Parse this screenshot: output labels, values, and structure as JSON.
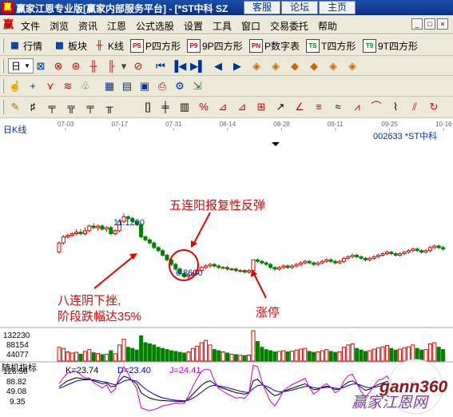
{
  "window": {
    "title": "赢家江恩专业版[赢家内部服务平台] - [*ST中科  SZ",
    "logo": "赢",
    "buttons": [
      "客服",
      "论坛",
      "主页"
    ]
  },
  "menu": {
    "items": [
      "文件",
      "浏览",
      "资讯",
      "江恩",
      "公式选股",
      "设置",
      "工具",
      "窗口",
      "交易委托",
      "帮助"
    ],
    "window_controls": [
      "_",
      "□",
      "×"
    ]
  },
  "toolbar1": {
    "items": [
      "行情",
      "板块",
      "K线",
      "P四方形",
      "9P四方形",
      "P数字表",
      "T四方形",
      "9T四方形"
    ],
    "icons": [
      "PS",
      "P9",
      "PN",
      "TS",
      "T9"
    ]
  },
  "toolbar2": {
    "period": "日"
  },
  "chart": {
    "title": "日K线",
    "stock": "002633 *ST中科",
    "dates": [
      "07-03",
      "07-17",
      "07-31",
      "08-14",
      "08-28",
      "09-11",
      "09-25",
      "10-16"
    ],
    "high_label": "11.1200",
    "low_label": "6.8600",
    "volume_ticks": [
      "132230",
      "88154",
      "44077"
    ],
    "indicator_name": "随机指标",
    "indicator_values": [
      "K=23.74",
      "D=23.40",
      "J=24.41"
    ],
    "indicator_ticks": [
      "126.56",
      "88.82",
      "49.08",
      "9.35"
    ],
    "annotations": [
      "五连阳报复性反弹",
      "八连阴下挫,",
      "阶段跌幅达35%",
      "涨停"
    ],
    "watermark": "gann360",
    "watermark_cn": "赢家江恩网"
  },
  "colors": {
    "up": "#e00000",
    "down": "#008000",
    "accent": "#003399",
    "annot": "#e60000"
  },
  "chart_data": {
    "type": "candlestick",
    "candles": [
      [
        8.6,
        9.3,
        8.5,
        9.2
      ],
      [
        9.2,
        9.7,
        9.1,
        9.6
      ],
      [
        9.6,
        9.8,
        9.5,
        9.7
      ],
      [
        9.7,
        9.9,
        9.6,
        9.8
      ],
      [
        9.8,
        10.1,
        9.7,
        9.9
      ],
      [
        9.9,
        10.1,
        9.7,
        9.8
      ],
      [
        9.8,
        10.2,
        9.7,
        10.0
      ],
      [
        10.0,
        10.4,
        9.9,
        10.3
      ],
      [
        10.3,
        10.5,
        10.1,
        10.2
      ],
      [
        10.2,
        10.4,
        10.0,
        10.3
      ],
      [
        10.3,
        10.4,
        10.0,
        10.1
      ],
      [
        10.1,
        10.3,
        9.9,
        10.2
      ],
      [
        10.2,
        10.3,
        9.7,
        9.8
      ],
      [
        9.8,
        10.1,
        9.7,
        10.0
      ],
      [
        10.0,
        10.7,
        9.9,
        10.6
      ],
      [
        10.6,
        11.1,
        10.5,
        10.9
      ],
      [
        10.9,
        11.0,
        10.7,
        10.8
      ],
      [
        10.8,
        10.9,
        10.5,
        10.6
      ],
      [
        10.6,
        10.7,
        10.3,
        10.4
      ],
      [
        10.4,
        10.5,
        9.5,
        9.6
      ],
      [
        9.6,
        9.7,
        9.3,
        9.4
      ],
      [
        9.4,
        9.5,
        9.1,
        9.2
      ],
      [
        9.2,
        9.3,
        8.8,
        8.9
      ],
      [
        8.9,
        9.0,
        8.6,
        8.7
      ],
      [
        8.7,
        8.8,
        8.3,
        8.4
      ],
      [
        8.4,
        8.5,
        8.0,
        8.1
      ],
      [
        8.1,
        8.2,
        7.7,
        7.8
      ],
      [
        7.8,
        7.9,
        7.4,
        7.5
      ],
      [
        7.5,
        7.6,
        7.1,
        7.2
      ],
      [
        7.2,
        7.3,
        6.9,
        7.0
      ],
      [
        7.0,
        7.2,
        6.86,
        7.1
      ],
      [
        7.1,
        7.3,
        7.0,
        7.2
      ],
      [
        7.2,
        7.5,
        7.1,
        7.4
      ],
      [
        7.4,
        7.7,
        7.3,
        7.6
      ],
      [
        7.6,
        7.8,
        7.5,
        7.7
      ],
      [
        7.7,
        7.9,
        7.6,
        7.8
      ],
      [
        7.8,
        7.9,
        7.6,
        7.7
      ],
      [
        7.7,
        7.8,
        7.5,
        7.6
      ],
      [
        7.6,
        7.7,
        7.5,
        7.6
      ],
      [
        7.6,
        7.7,
        7.4,
        7.5
      ],
      [
        7.5,
        7.6,
        7.4,
        7.5
      ],
      [
        7.5,
        7.6,
        7.3,
        7.4
      ],
      [
        7.4,
        7.5,
        7.3,
        7.4
      ],
      [
        7.4,
        7.5,
        7.2,
        7.3
      ],
      [
        7.3,
        7.5,
        7.2,
        7.4
      ],
      [
        7.4,
        8.1,
        7.4,
        8.1
      ],
      [
        8.1,
        8.2,
        7.9,
        8.0
      ],
      [
        8.0,
        8.1,
        7.8,
        7.9
      ],
      [
        7.9,
        8.0,
        7.7,
        7.8
      ],
      [
        7.8,
        7.9,
        7.5,
        7.6
      ],
      [
        7.6,
        7.7,
        7.4,
        7.5
      ],
      [
        7.5,
        7.7,
        7.4,
        7.6
      ],
      [
        7.6,
        7.8,
        7.5,
        7.7
      ],
      [
        7.7,
        7.8,
        7.5,
        7.6
      ],
      [
        7.6,
        7.8,
        7.5,
        7.7
      ],
      [
        7.7,
        7.9,
        7.6,
        7.8
      ],
      [
        7.8,
        8.0,
        7.7,
        7.9
      ],
      [
        7.9,
        8.1,
        7.8,
        8.0
      ],
      [
        8.0,
        8.1,
        7.8,
        7.9
      ],
      [
        7.9,
        8.0,
        7.7,
        7.8
      ],
      [
        7.8,
        8.0,
        7.7,
        7.9
      ],
      [
        7.9,
        8.1,
        7.8,
        8.0
      ],
      [
        8.0,
        8.2,
        7.9,
        8.1
      ],
      [
        8.1,
        8.2,
        7.9,
        8.0
      ],
      [
        8.0,
        8.1,
        7.8,
        7.9
      ],
      [
        7.9,
        8.1,
        7.8,
        8.0
      ],
      [
        8.0,
        8.3,
        7.9,
        8.2
      ],
      [
        8.2,
        8.4,
        8.1,
        8.3
      ],
      [
        8.3,
        8.5,
        8.2,
        8.4
      ],
      [
        8.4,
        8.5,
        8.2,
        8.3
      ],
      [
        8.3,
        8.4,
        8.1,
        8.2
      ],
      [
        8.2,
        8.3,
        8.0,
        8.1
      ],
      [
        8.1,
        8.3,
        8.0,
        8.2
      ],
      [
        8.2,
        8.4,
        8.1,
        8.3
      ],
      [
        8.3,
        8.5,
        8.2,
        8.4
      ],
      [
        8.4,
        8.6,
        8.3,
        8.5
      ],
      [
        8.5,
        8.7,
        8.4,
        8.6
      ],
      [
        8.6,
        8.7,
        8.4,
        8.5
      ],
      [
        8.5,
        8.6,
        8.3,
        8.4
      ],
      [
        8.4,
        8.6,
        8.3,
        8.5
      ],
      [
        8.5,
        8.7,
        8.4,
        8.6
      ],
      [
        8.6,
        8.8,
        8.5,
        8.7
      ],
      [
        8.7,
        8.9,
        8.6,
        8.8
      ],
      [
        8.8,
        8.9,
        8.6,
        8.7
      ],
      [
        8.7,
        8.8,
        8.5,
        8.6
      ],
      [
        8.6,
        8.8,
        8.5,
        8.7
      ],
      [
        8.7,
        9.0,
        8.6,
        8.9
      ],
      [
        8.9,
        9.1,
        8.8,
        9.0
      ],
      [
        9.0,
        9.1,
        8.8,
        8.9
      ],
      [
        8.9,
        9.0,
        8.7,
        8.8
      ]
    ],
    "volume": [
      60,
      55,
      40,
      35,
      38,
      30,
      42,
      50,
      36,
      33,
      28,
      30,
      45,
      32,
      70,
      95,
      60,
      55,
      48,
      110,
      80,
      75,
      70,
      60,
      55,
      50,
      45,
      42,
      38,
      35,
      40,
      55,
      65,
      80,
      90,
      70,
      50,
      45,
      40,
      35,
      30,
      28,
      25,
      24,
      26,
      132,
      85,
      60,
      50,
      45,
      40,
      42,
      45,
      40,
      43,
      48,
      52,
      55,
      42,
      38,
      40,
      45,
      50,
      42,
      38,
      40,
      60,
      70,
      75,
      55,
      48,
      42,
      45,
      52,
      58,
      62,
      68,
      55,
      48,
      52,
      58,
      62,
      70,
      55,
      48,
      50,
      75,
      80,
      60,
      50
    ],
    "kdj": {
      "K": [
        60,
        70,
        80,
        85,
        90,
        88,
        85,
        86,
        80,
        75,
        70,
        72,
        60,
        62,
        80,
        95,
        90,
        80,
        70,
        40,
        30,
        22,
        18,
        15,
        14,
        13,
        12,
        12,
        11,
        10,
        20,
        35,
        50,
        65,
        75,
        80,
        70,
        60,
        55,
        50,
        45,
        40,
        38,
        35,
        40,
        80,
        85,
        70,
        55,
        40,
        30,
        35,
        45,
        50,
        55,
        60,
        65,
        70,
        60,
        50,
        52,
        58,
        62,
        58,
        50,
        52,
        65,
        75,
        80,
        70,
        58,
        48,
        52,
        60,
        68,
        72,
        78,
        70,
        60,
        62,
        68,
        74,
        80,
        72,
        60,
        58,
        72,
        78,
        70,
        62
      ],
      "D": [
        55,
        60,
        67,
        73,
        79,
        82,
        83,
        84,
        83,
        80,
        77,
        75,
        70,
        67,
        71,
        79,
        83,
        82,
        78,
        65,
        53,
        43,
        35,
        28,
        23,
        20,
        17,
        15,
        14,
        13,
        15,
        22,
        31,
        42,
        53,
        62,
        65,
        63,
        60,
        57,
        53,
        49,
        45,
        42,
        41,
        54,
        64,
        66,
        62,
        55,
        47,
        43,
        44,
        46,
        49,
        53,
        57,
        61,
        61,
        57,
        55,
        56,
        58,
        58,
        55,
        54,
        58,
        64,
        69,
        69,
        65,
        59,
        57,
        58,
        61,
        65,
        69,
        69,
        66,
        65,
        66,
        69,
        73,
        73,
        69,
        65,
        67,
        71,
        71,
        68
      ],
      "J": [
        70,
        90,
        106,
        109,
        112,
        100,
        89,
        90,
        74,
        65,
        56,
        66,
        40,
        52,
        98,
        127,
        104,
        76,
        54,
        -10,
        -16,
        -20,
        -16,
        -11,
        -4,
        -1,
        2,
        6,
        5,
        4,
        30,
        61,
        88,
        111,
        119,
        116,
        80,
        54,
        45,
        36,
        29,
        22,
        24,
        21,
        38,
        132,
        127,
        78,
        41,
        10,
        -4,
        19,
        47,
        58,
        67,
        74,
        81,
        88,
        58,
        36,
        46,
        62,
        70,
        58,
        40,
        48,
        79,
        97,
        102,
        72,
        44,
        26,
        42,
        64,
        82,
        86,
        96,
        72,
        48,
        56,
        72,
        84,
        94,
        70,
        42,
        44,
        82,
        92,
        68,
        50
      ]
    }
  }
}
